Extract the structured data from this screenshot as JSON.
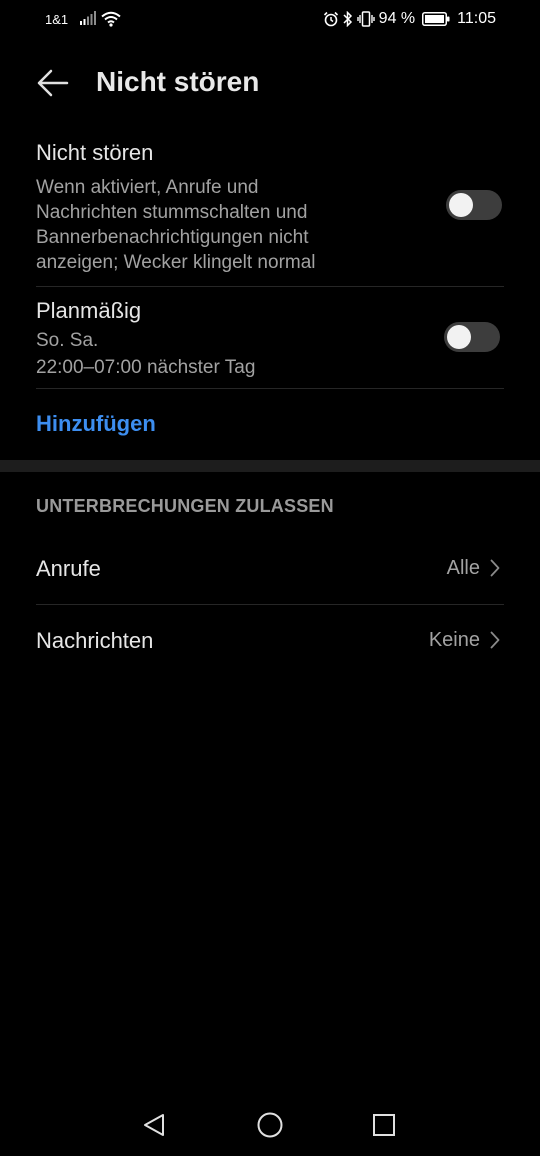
{
  "status_bar": {
    "carrier": "1&1",
    "battery": "94 %",
    "time": "11:05",
    "icons": [
      "signal-icon",
      "wifi-icon",
      "alarm-icon",
      "bluetooth-icon",
      "vibrate-icon",
      "battery-icon"
    ]
  },
  "header": {
    "title": "Nicht stören",
    "back_icon": "arrow-left-icon"
  },
  "dnd": {
    "title": "Nicht stören",
    "description_lines": [
      "Wenn aktiviert, Anrufe und",
      "Nachrichten stummschalten und",
      "Bannerbenachrichtigungen nicht",
      "anzeigen; Wecker klingelt normal"
    ],
    "enabled": false
  },
  "schedule": {
    "title": "Planmäßig",
    "days": "So. Sa.",
    "time_range": "22:00–07:00 nächster Tag",
    "enabled": false
  },
  "add_label": "Hinzufügen",
  "interruptions": {
    "header": "UNTERBRECHUNGEN ZULASSEN",
    "items": [
      {
        "label": "Anrufe",
        "value": "Alle"
      },
      {
        "label": "Nachrichten",
        "value": "Keine"
      }
    ]
  },
  "navigation": {
    "buttons": [
      "back-triangle-icon",
      "home-circle-icon",
      "recents-square-icon"
    ]
  },
  "colors": {
    "background": "#000000",
    "accent": "#3d8ef0",
    "primary_text": "#e6e6e6",
    "secondary_text": "#a2a2a2",
    "toggle_track_off": "#3d3d3d"
  }
}
